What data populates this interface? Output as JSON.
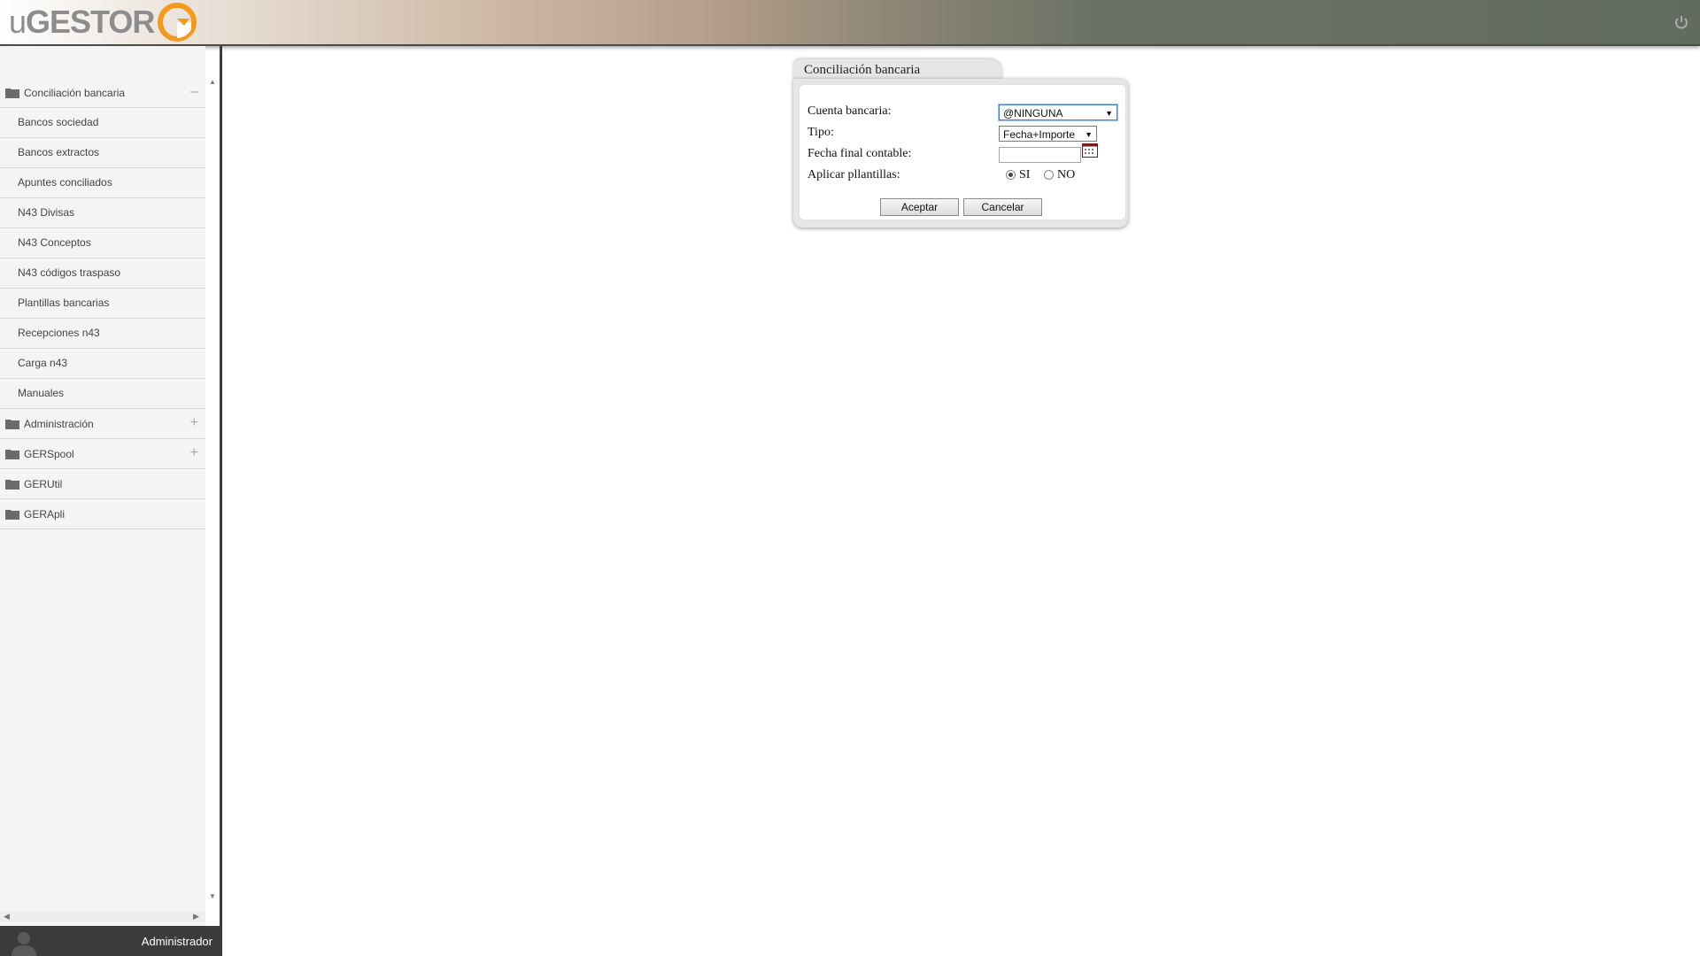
{
  "header": {
    "logo_u": "u",
    "logo_gestor": "GESTOR",
    "power_icon": "power-icon"
  },
  "sidebar": {
    "groups": [
      {
        "label": "Conciliación bancaria",
        "toggle": "–",
        "expanded": true,
        "items": [
          {
            "label": "Bancos sociedad"
          },
          {
            "label": "Bancos extractos"
          },
          {
            "label": "Apuntes conciliados"
          },
          {
            "label": "N43 Divisas"
          },
          {
            "label": "N43 Conceptos"
          },
          {
            "label": "N43 códigos traspaso"
          },
          {
            "label": "Plantillas bancarias"
          },
          {
            "label": "Recepciones n43"
          },
          {
            "label": "Carga n43"
          },
          {
            "label": "Manuales"
          }
        ]
      },
      {
        "label": "Administración",
        "toggle": "+"
      },
      {
        "label": "GERSpool",
        "toggle": "+"
      },
      {
        "label": "GERUtil",
        "toggle": ""
      },
      {
        "label": "GERApli",
        "toggle": ""
      }
    ]
  },
  "user": {
    "name": "Administrador"
  },
  "dialog": {
    "title": "Conciliación bancaria",
    "fields": {
      "cuenta_label": "Cuenta bancaria:",
      "cuenta_value": "@NINGUNA",
      "tipo_label": "Tipo:",
      "tipo_value": "Fecha+Importe",
      "fecha_label": "Fecha final contable:",
      "fecha_value": "",
      "plantillas_label": "Aplicar pllantillas:",
      "si_label": "SI",
      "no_label": "NO",
      "plantillas_selected": "SI"
    },
    "buttons": {
      "accept": "Aceptar",
      "cancel": "Cancelar"
    }
  },
  "colors": {
    "accent_orange": "#f39a1e",
    "sidebar_bg": "#f4f4f4",
    "userbar_bg": "#3b3b3b"
  }
}
